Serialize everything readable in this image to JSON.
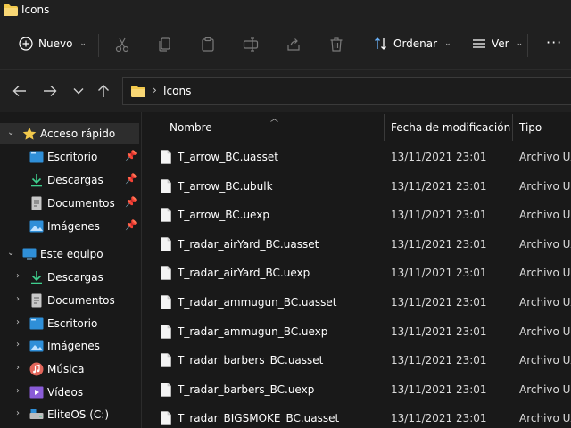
{
  "window": {
    "title": "Icons"
  },
  "toolbar": {
    "new_label": "Nuevo",
    "sort_label": "Ordenar",
    "view_label": "Ver",
    "more_label": "···"
  },
  "address": {
    "path": "Icons",
    "separator": "›"
  },
  "sidebar": {
    "quick_access": {
      "label": "Acceso rápido",
      "items": [
        {
          "label": "Escritorio",
          "icon": "desktop-icon"
        },
        {
          "label": "Descargas",
          "icon": "download-icon"
        },
        {
          "label": "Documentos",
          "icon": "document-icon"
        },
        {
          "label": "Imágenes",
          "icon": "pictures-icon"
        }
      ]
    },
    "this_pc": {
      "label": "Este equipo",
      "items": [
        {
          "label": "Descargas",
          "icon": "download-icon"
        },
        {
          "label": "Documentos",
          "icon": "document-icon"
        },
        {
          "label": "Escritorio",
          "icon": "desktop-icon"
        },
        {
          "label": "Imágenes",
          "icon": "pictures-icon"
        },
        {
          "label": "Música",
          "icon": "music-icon"
        },
        {
          "label": "Vídeos",
          "icon": "video-icon"
        },
        {
          "label": "EliteOS (C:)",
          "icon": "drive-icon"
        }
      ]
    }
  },
  "columns": {
    "name": "Nombre",
    "date": "Fecha de modificación",
    "type": "Tipo"
  },
  "files": [
    {
      "name": "T_arrow_BC.uasset",
      "date": "13/11/2021 23:01",
      "type": "Archivo UA"
    },
    {
      "name": "T_arrow_BC.ubulk",
      "date": "13/11/2021 23:01",
      "type": "Archivo UB"
    },
    {
      "name": "T_arrow_BC.uexp",
      "date": "13/11/2021 23:01",
      "type": "Archivo UE"
    },
    {
      "name": "T_radar_airYard_BC.uasset",
      "date": "13/11/2021 23:01",
      "type": "Archivo UA"
    },
    {
      "name": "T_radar_airYard_BC.uexp",
      "date": "13/11/2021 23:01",
      "type": "Archivo UE"
    },
    {
      "name": "T_radar_ammugun_BC.uasset",
      "date": "13/11/2021 23:01",
      "type": "Archivo UA"
    },
    {
      "name": "T_radar_ammugun_BC.uexp",
      "date": "13/11/2021 23:01",
      "type": "Archivo UE"
    },
    {
      "name": "T_radar_barbers_BC.uasset",
      "date": "13/11/2021 23:01",
      "type": "Archivo UA"
    },
    {
      "name": "T_radar_barbers_BC.uexp",
      "date": "13/11/2021 23:01",
      "type": "Archivo UE"
    },
    {
      "name": "T_radar_BIGSMOKE_BC.uasset",
      "date": "13/11/2021 23:01",
      "type": "Archivo UA"
    }
  ],
  "colors": {
    "background": "#191919",
    "toolbar": "#202020",
    "folder": "#f2c94c",
    "selected": "#2d2d2d"
  }
}
